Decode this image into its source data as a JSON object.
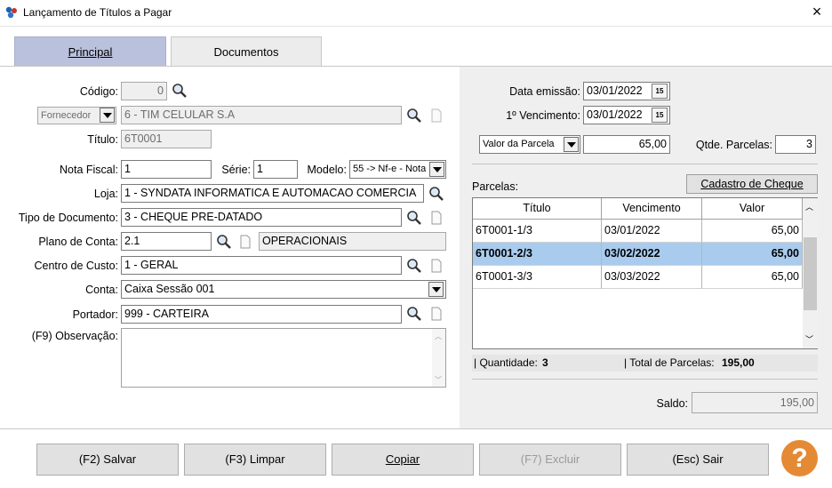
{
  "window": {
    "title": "Lançamento de Títulos a Pagar",
    "close_glyph": "×"
  },
  "tabs": [
    {
      "label": "Principal",
      "active": true
    },
    {
      "label": "Documentos",
      "active": false
    }
  ],
  "form": {
    "codigo": {
      "label": "Código:",
      "value": "0"
    },
    "tipo_pessoa": {
      "value": "Fornecedor"
    },
    "fornecedor": {
      "value": "6 - TIM CELULAR S.A"
    },
    "titulo": {
      "label": "Título:",
      "value": "6T0001"
    },
    "nota_fiscal": {
      "label": "Nota Fiscal:",
      "value": "1"
    },
    "serie": {
      "label": "Série:",
      "value": "1"
    },
    "modelo": {
      "label": "Modelo:",
      "value": "55 -> Nf-e - Nota"
    },
    "loja": {
      "label": "Loja:",
      "value": "1 - SYNDATA INFORMATICA E AUTOMACAO COMERCIA"
    },
    "tipo_documento": {
      "label": "Tipo de Documento:",
      "value": "3 - CHEQUE PRE-DATADO"
    },
    "plano_conta": {
      "label": "Plano de Conta:",
      "value": "2.1",
      "description": "OPERACIONAIS"
    },
    "centro_custo": {
      "label": "Centro de Custo:",
      "value": "1 - GERAL"
    },
    "conta": {
      "label": "Conta:",
      "value": "Caixa Sessão 001"
    },
    "portador": {
      "label": "Portador:",
      "value": "999 - CARTEIRA"
    },
    "observacao": {
      "label": "(F9) Observação:",
      "value": ""
    }
  },
  "right": {
    "data_emissao": {
      "label": "Data emissão:",
      "value": "03/01/2022"
    },
    "primeiro_vencimento": {
      "label": "1º Vencimento:",
      "value": "03/01/2022"
    },
    "calendar_glyph": "15",
    "valor_tipo": {
      "value": "Valor da Parcela"
    },
    "valor": {
      "value": "65,00"
    },
    "qtde_parcelas": {
      "label": "Qtde. Parcelas:",
      "value": "3"
    },
    "parcelas_label": "Parcelas:",
    "cadastro_cheque": "Cadastro de Cheque",
    "grid": {
      "headers": [
        "Título",
        "Vencimento",
        "Valor"
      ],
      "rows": [
        {
          "titulo": "6T0001-1/3",
          "vencimento": "03/01/2022",
          "valor": "65,00"
        },
        {
          "titulo": "6T0001-2/3",
          "vencimento": "03/02/2022",
          "valor": "65,00"
        },
        {
          "titulo": "6T0001-3/3",
          "vencimento": "03/03/2022",
          "valor": "65,00"
        }
      ]
    },
    "quantidade_label": "| Quantidade:",
    "quantidade_value": "3",
    "total_label": "| Total de Parcelas:",
    "total_value": "195,00",
    "saldo": {
      "label": "Saldo:",
      "value": "195,00"
    }
  },
  "buttons": {
    "salvar": "(F2) Salvar",
    "limpar": "(F3) Limpar",
    "copiar": "Copiar",
    "excluir": "(F7) Excluir",
    "sair": "(Esc) Sair",
    "help_glyph": "?"
  },
  "colors": {
    "tab_active": "#b9c1dc",
    "selected_row": "#a9ccee",
    "help": "#e58a34"
  }
}
